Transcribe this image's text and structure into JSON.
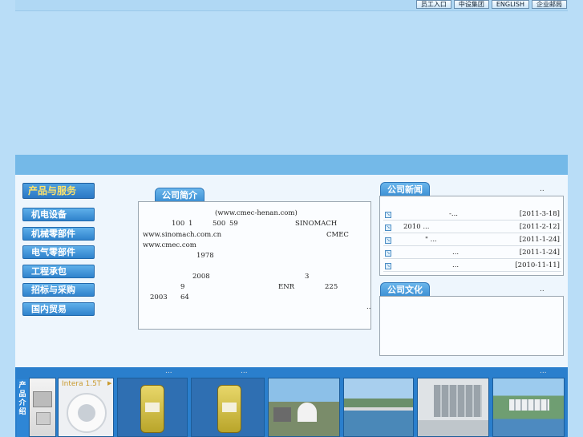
{
  "top_links": [
    "员工入口",
    "中设集团",
    "ENGLISH",
    "企业邮局"
  ],
  "sidebar": {
    "title": "产品与服务",
    "items": [
      "机电设备",
      "机械零部件",
      "电气零部件",
      "工程承包",
      "招标与采购",
      "国内贸易"
    ]
  },
  "intro": {
    "tab": "公司简介",
    "lines": [
      [
        "(www.cmec-henan.com)"
      ],
      [
        "100",
        "1",
        "500",
        "59",
        "SINOMACH"
      ],
      [
        "www.sinomach.com.cn",
        "CMEC"
      ],
      [
        "www.cmec.com"
      ],
      [
        "1978"
      ],
      [
        "2008",
        "3"
      ],
      [
        "9",
        "ENR",
        "225"
      ],
      [
        "2003",
        "64"
      ]
    ],
    "more": ".."
  },
  "news": {
    "tab": "公司新闻",
    "more": "..",
    "items": [
      {
        "title": "-...",
        "date": "[2011-3-18]"
      },
      {
        "title": "2010 ...",
        "date": "[2011-2-12]"
      },
      {
        "title": "\" ...",
        "date": "[2011-1-24]"
      },
      {
        "title": "...",
        "date": "[2011-1-24]"
      },
      {
        "title": "...",
        "date": "[2010-11-11]"
      }
    ]
  },
  "culture": {
    "tab": "公司文化",
    "more": ".."
  },
  "products": {
    "label": "产品介绍",
    "dots": [
      "...",
      "...",
      "..."
    ],
    "thumb_caption": "Intera 1.5T"
  },
  "colors": {
    "background": "#b9ddf7",
    "accent": "#2a7fcd",
    "tab": "#3c8fd3",
    "sidebar_title_text": "#ffe36b"
  }
}
